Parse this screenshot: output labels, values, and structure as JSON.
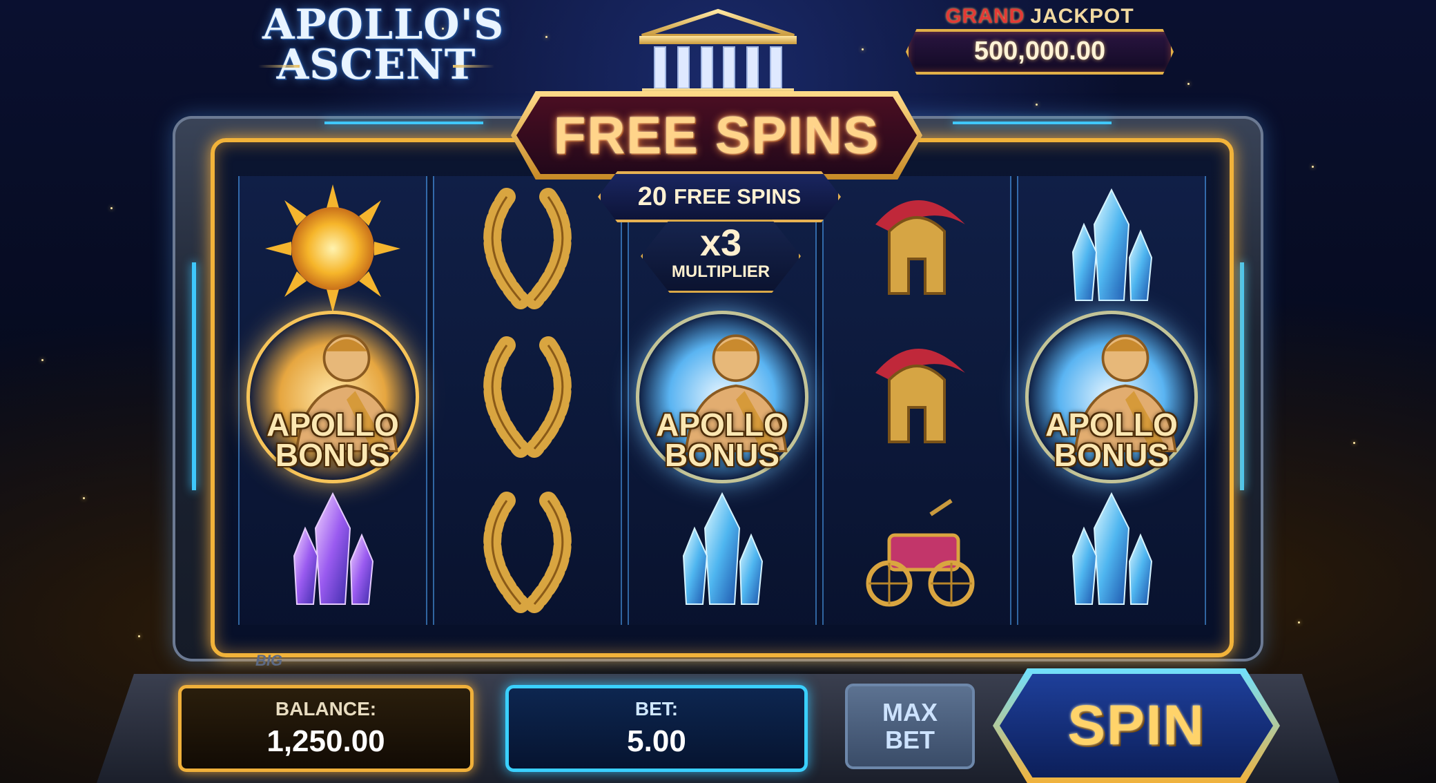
{
  "game": {
    "logo_line1": "APOLLO'S",
    "logo_line2": "ASCENT"
  },
  "jackpot": {
    "title_grand": "GRAND",
    "title_rest": "JACKPOT",
    "value": "500,000.00"
  },
  "free_spins": {
    "title": "FREE SPINS",
    "count": "20",
    "count_label": "FREE SPINS",
    "multiplier": "x3",
    "multiplier_label": "MULTIPLIER"
  },
  "reels": [
    [
      "sun",
      "apollo-bonus",
      "purple-crystal"
    ],
    [
      "laurel-wreath",
      "laurel-wreath",
      "laurel-wreath"
    ],
    [
      "multiplier-slot",
      "apollo-bonus",
      "blue-crystal"
    ],
    [
      "spartan-helmet",
      "spartan-helmet",
      "chariot"
    ],
    [
      "blue-crystal",
      "apollo-bonus",
      "blue-crystal"
    ]
  ],
  "bonus_label_line1": "APOLLO",
  "bonus_label_line2": "BONUS",
  "frame_tag": "BIG",
  "controls": {
    "balance_label": "BALANCE:",
    "balance_value": "1,250.00",
    "bet_label": "BET:",
    "bet_value": "5.00",
    "maxbet_line1": "MAX",
    "maxbet_line2": "BET",
    "spin_label": "SPIN"
  },
  "colors": {
    "gold": "#f0b03a",
    "neon_blue": "#3ad0ff",
    "banner_red": "#4a0e22"
  }
}
